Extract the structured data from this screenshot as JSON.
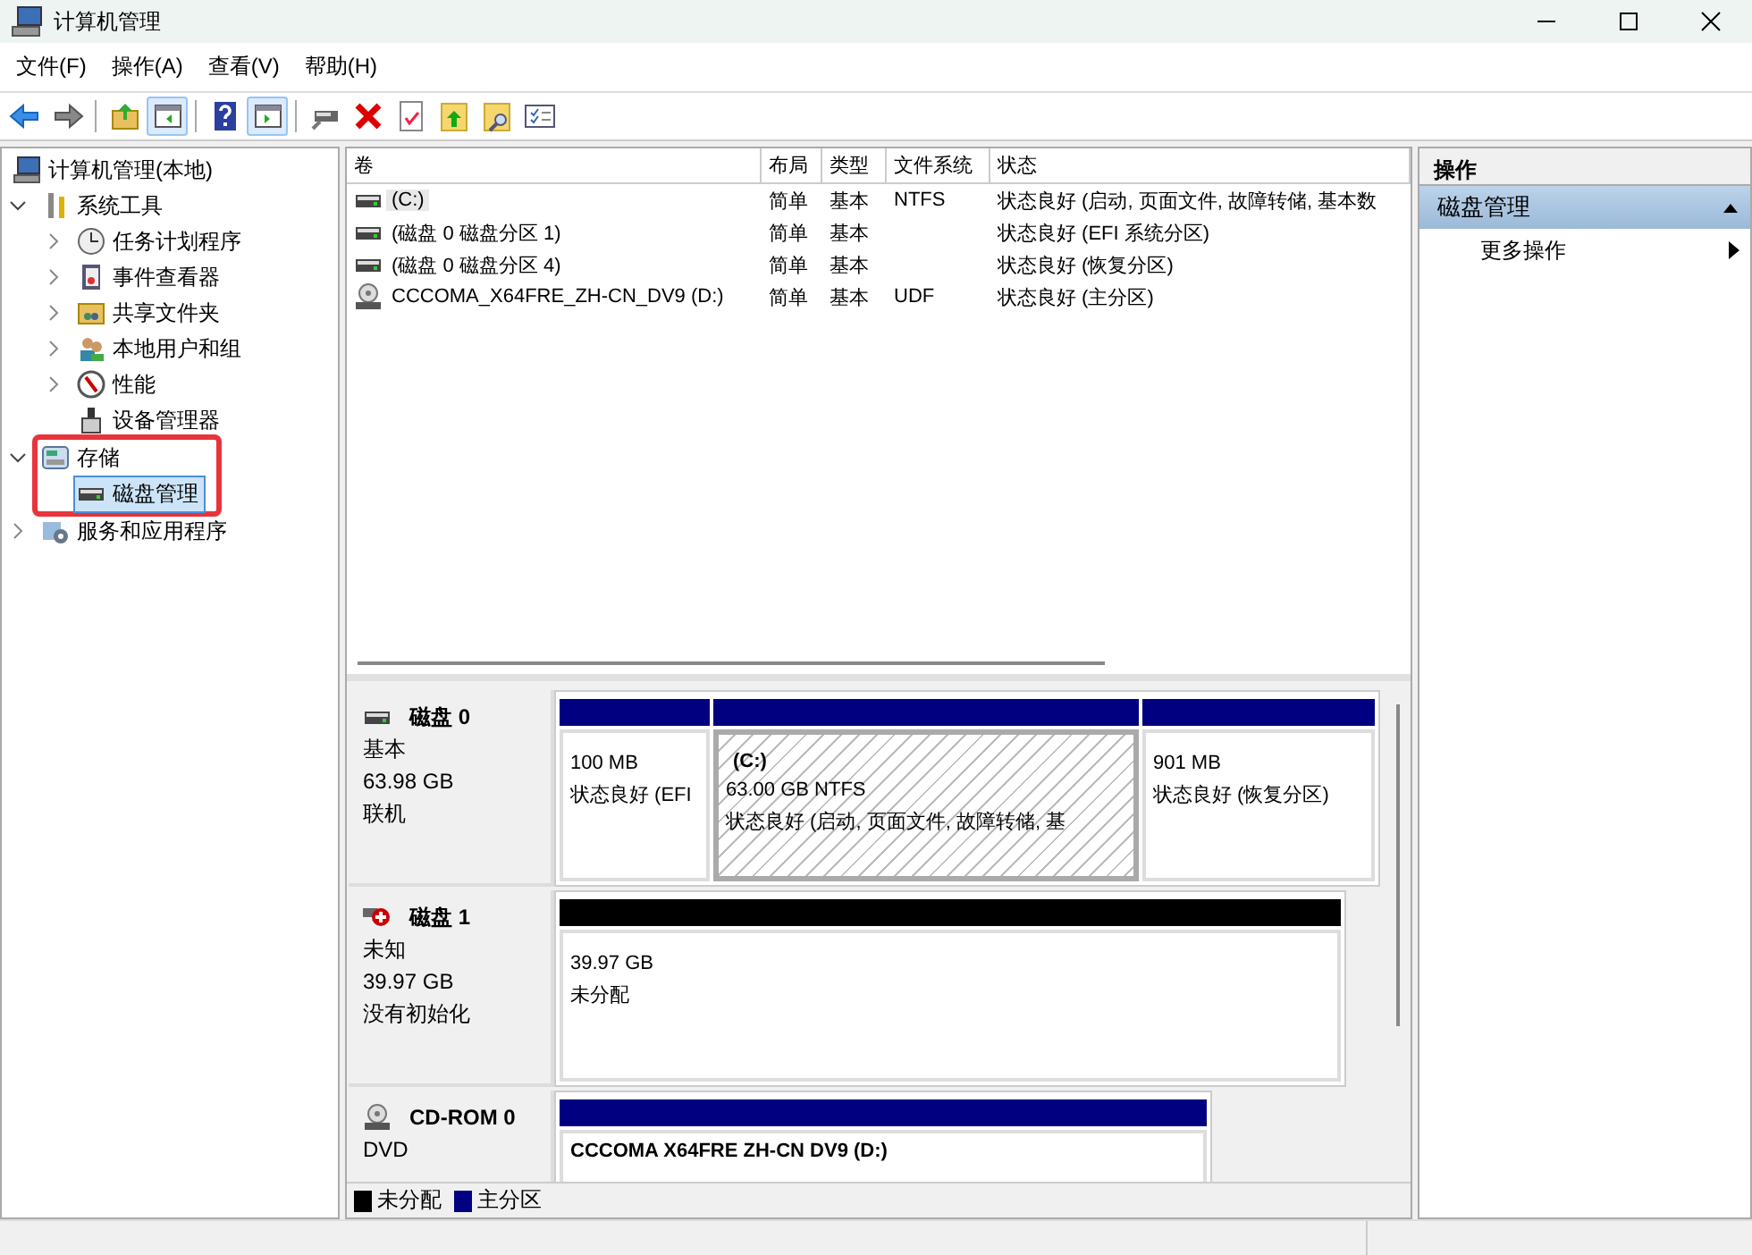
{
  "window": {
    "title": "计算机管理"
  },
  "menu": [
    {
      "label": "文件(F)"
    },
    {
      "label": "操作(A)"
    },
    {
      "label": "查看(V)"
    },
    {
      "label": "帮助(H)"
    }
  ],
  "toolbar": [
    {
      "kind": "back",
      "pressed": false
    },
    {
      "kind": "forward",
      "pressed": false
    },
    {
      "kind": "sep"
    },
    {
      "kind": "up",
      "pressed": false
    },
    {
      "kind": "pane-left",
      "pressed": true
    },
    {
      "kind": "sep"
    },
    {
      "kind": "help",
      "pressed": false
    },
    {
      "kind": "pane-right",
      "pressed": true
    },
    {
      "kind": "sep"
    },
    {
      "kind": "connect",
      "pressed": false
    },
    {
      "kind": "delete",
      "pressed": false
    },
    {
      "kind": "check",
      "pressed": false
    },
    {
      "kind": "export",
      "pressed": false
    },
    {
      "kind": "find",
      "pressed": false
    },
    {
      "kind": "list",
      "pressed": false
    }
  ],
  "tree": [
    {
      "label": "计算机管理(本地)",
      "kind": "computer",
      "selected": false,
      "children": [
        {
          "label": "系统工具",
          "kind": "tools",
          "expanded": true,
          "selected": false,
          "highlighted": false,
          "children": [
            {
              "label": "任务计划程序",
              "kind": "clock",
              "expanded": false,
              "selected": false
            },
            {
              "label": "事件查看器",
              "kind": "log",
              "expanded": false,
              "selected": false
            },
            {
              "label": "共享文件夹",
              "kind": "share",
              "expanded": false,
              "selected": false
            },
            {
              "label": "本地用户和组",
              "kind": "users",
              "expanded": false,
              "selected": false
            },
            {
              "label": "性能",
              "kind": "gauge",
              "expanded": false,
              "selected": false
            },
            {
              "label": "设备管理器",
              "kind": "device",
              "selected": false
            }
          ]
        },
        {
          "label": "存储",
          "kind": "storage",
          "expanded": true,
          "selected": false,
          "highlighted": true,
          "children": [
            {
              "label": "磁盘管理",
              "kind": "disk",
              "selected": true
            }
          ]
        },
        {
          "label": "服务和应用程序",
          "kind": "services",
          "expanded": false,
          "selected": false,
          "highlighted": false
        }
      ]
    }
  ],
  "volumes": {
    "columns": [
      "卷",
      "布局",
      "类型",
      "文件系统",
      "状态"
    ],
    "rows": [
      {
        "kind": "disk",
        "selected": true,
        "cells": [
          "(C:)",
          "简单",
          "基本",
          "NTFS",
          "状态良好 (启动, 页面文件, 故障转储, 基本数"
        ]
      },
      {
        "kind": "disk",
        "selected": false,
        "cells": [
          "(磁盘 0 磁盘分区 1)",
          "简单",
          "基本",
          "",
          "状态良好 (EFI 系统分区)"
        ]
      },
      {
        "kind": "disk",
        "selected": false,
        "cells": [
          "(磁盘 0 磁盘分区 4)",
          "简单",
          "基本",
          "",
          "状态良好 (恢复分区)"
        ]
      },
      {
        "kind": "cd",
        "selected": false,
        "cells": [
          "CCCOMA_X64FRE_ZH-CN_DV9 (D:)",
          "简单",
          "基本",
          "UDF",
          "状态良好 (主分区)"
        ]
      }
    ]
  },
  "disks": [
    {
      "name": "磁盘 0",
      "kind": "disk",
      "type": "基本",
      "size": "63.98 GB",
      "status": "联机",
      "partitions": [
        {
          "kind": "primary",
          "selected": false,
          "size": "100 MB",
          "status": "状态良好 (EFI"
        },
        {
          "kind": "primary",
          "selected": true,
          "label": "(C:)",
          "size": "63.00 GB NTFS",
          "status": "状态良好 (启动, 页面文件, 故障转储, 基"
        },
        {
          "kind": "primary",
          "selected": false,
          "size": "901 MB",
          "status": "状态良好 (恢复分区)"
        }
      ]
    },
    {
      "name": "磁盘 1",
      "kind": "disk-error",
      "type": "未知",
      "size": "39.97 GB",
      "status": "没有初始化",
      "partitions": [
        {
          "kind": "unallocated",
          "selected": false,
          "size": "39.97 GB",
          "status": "未分配"
        }
      ]
    },
    {
      "name": "CD-ROM 0",
      "kind": "cd",
      "type": "DVD",
      "partitions": [
        {
          "kind": "primary",
          "selected": false,
          "label": "CCCOMA X64FRE ZH-CN DV9  (D:)"
        }
      ]
    }
  ],
  "legend": [
    {
      "label": "未分配",
      "color": "#000000"
    },
    {
      "label": "主分区",
      "color": "#000080"
    }
  ],
  "actions": {
    "title": "操作",
    "sections": [
      {
        "label": "磁盘管理",
        "expanded": true,
        "items": [
          {
            "label": "更多操作"
          }
        ]
      }
    ]
  }
}
